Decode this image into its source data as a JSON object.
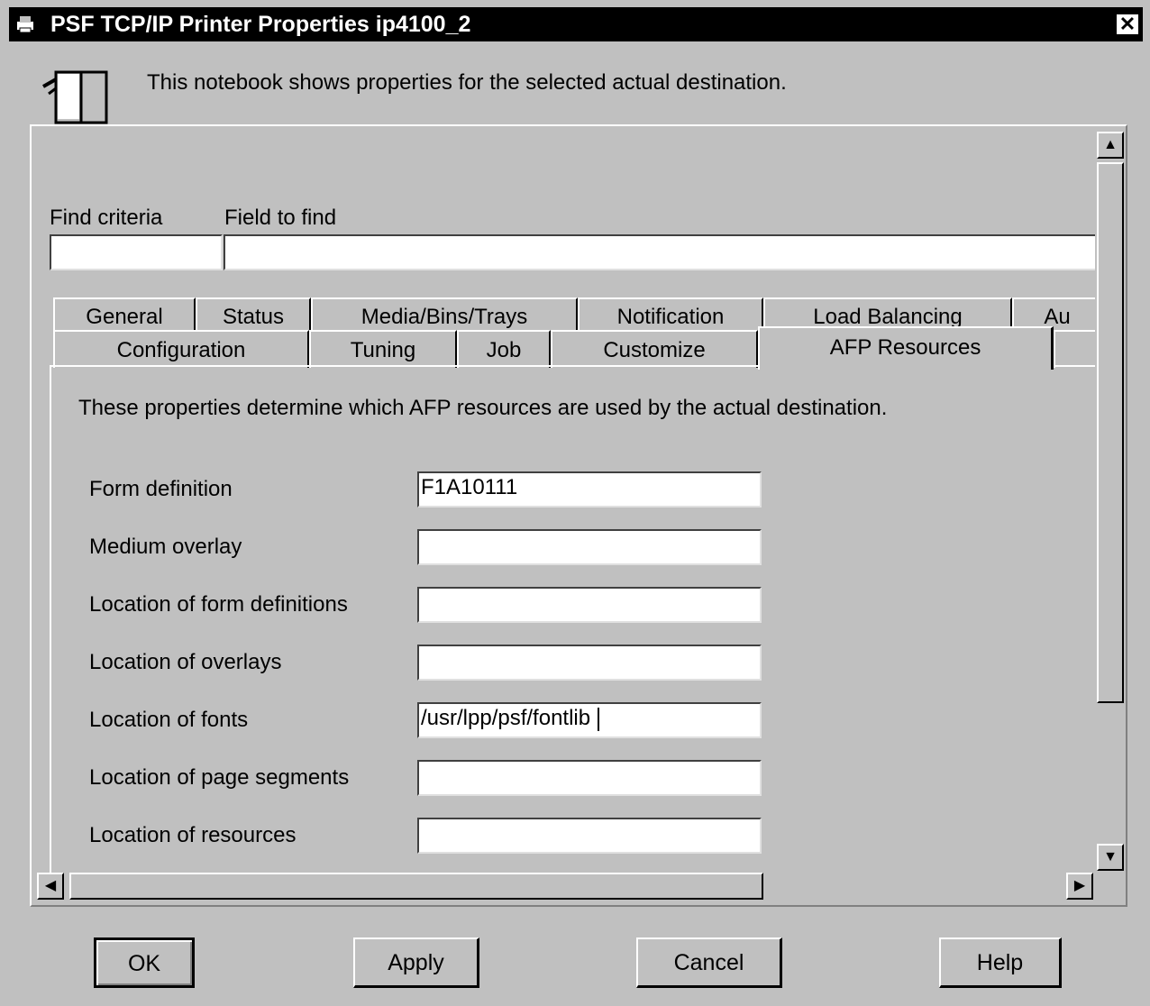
{
  "window": {
    "title": "PSF TCP/IP Printer Properties ip4100_2",
    "close_symbol": "✕",
    "title_icon": "printer-app-icon"
  },
  "header": {
    "icon": "printer-icon",
    "description": "This notebook shows properties for the selected actual destination."
  },
  "find": {
    "criteria_label": "Find criteria",
    "criteria_value": "",
    "field_label": "Field to find",
    "field_value": ""
  },
  "tabs": {
    "back_row": [
      "General",
      "Status",
      "Media/Bins/Trays",
      "Notification",
      "Load Balancing",
      "Au"
    ],
    "front_row": [
      "Configuration",
      "Tuning",
      "Job",
      "Customize",
      "AFP Resources"
    ],
    "active": "AFP Resources"
  },
  "afp": {
    "description": "These properties determine which AFP resources are used by the actual destination.",
    "fields": [
      {
        "label": "Form definition",
        "value": "F1A10111"
      },
      {
        "label": "Medium overlay",
        "value": ""
      },
      {
        "label": "Location of form definitions",
        "value": ""
      },
      {
        "label": "Location of overlays",
        "value": ""
      },
      {
        "label": "Location of fonts",
        "value": "/usr/lpp/psf/fontlib"
      },
      {
        "label": "Location of page segments",
        "value": ""
      },
      {
        "label": "Location of resources",
        "value": ""
      }
    ]
  },
  "scroll": {
    "up": "▲",
    "down": "▼",
    "left": "◀",
    "right": "▶"
  },
  "buttons": {
    "ok": "OK",
    "apply": "Apply",
    "cancel": "Cancel",
    "help": "Help"
  }
}
